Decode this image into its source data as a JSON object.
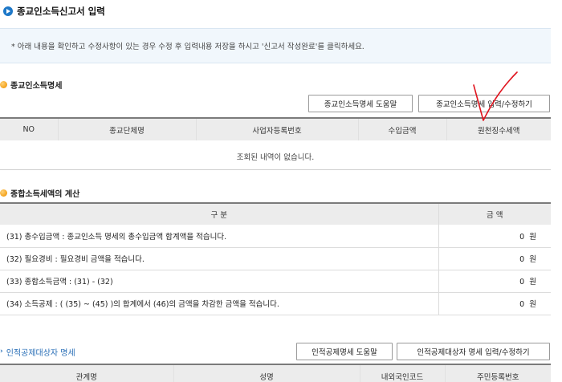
{
  "page": {
    "title": "종교인소득신고서 입력"
  },
  "notice": {
    "text": "* 아래 내용을 확인하고 수정사항이 있는 경우 수정 후 입력내용 저장을 하시고 '신고서 작성완료'를 클릭하세요."
  },
  "section1": {
    "title": "종교인소득명세",
    "help_button": "종교인소득명세 도움말",
    "edit_button": "종교인소득명세 입력/수정하기",
    "columns": [
      "NO",
      "종교단체명",
      "사업자등록번호",
      "수입금액",
      "원천징수세액"
    ],
    "empty_message": "조회된 내역이 없습니다."
  },
  "section2": {
    "title": "종합소득세액의 계산",
    "col_category": "구    분",
    "col_amount": "금  액",
    "rows": [
      {
        "label": "(31) 총수입금액 : 종교인소득 명세의 총수입금액 합계액을 적습니다.",
        "amount": "0",
        "unit": "원"
      },
      {
        "label": "(32) 필요경비 : 필요경비 금액을 적습니다.",
        "amount": "0",
        "unit": "원"
      },
      {
        "label": "(33) 종합소득금액 : (31) - (32)",
        "amount": "0",
        "unit": "원"
      },
      {
        "label": "(34) 소득공제 : ( (35) ~ (45) )의 합계에서 (46)의 금액을 차감한 금액을 적습니다.",
        "amount": "0",
        "unit": "원"
      }
    ]
  },
  "section3": {
    "title": "인적공제대상자 명세",
    "help_button": "인적공제명세 도움말",
    "edit_button": "인적공제대상자 명세 입력/수정하기",
    "columns": [
      "관계명",
      "성명",
      "내외국인코드",
      "주민등록번호"
    ]
  },
  "colors": {
    "accent": "#1e78c8",
    "annotation": "#e0141e"
  }
}
